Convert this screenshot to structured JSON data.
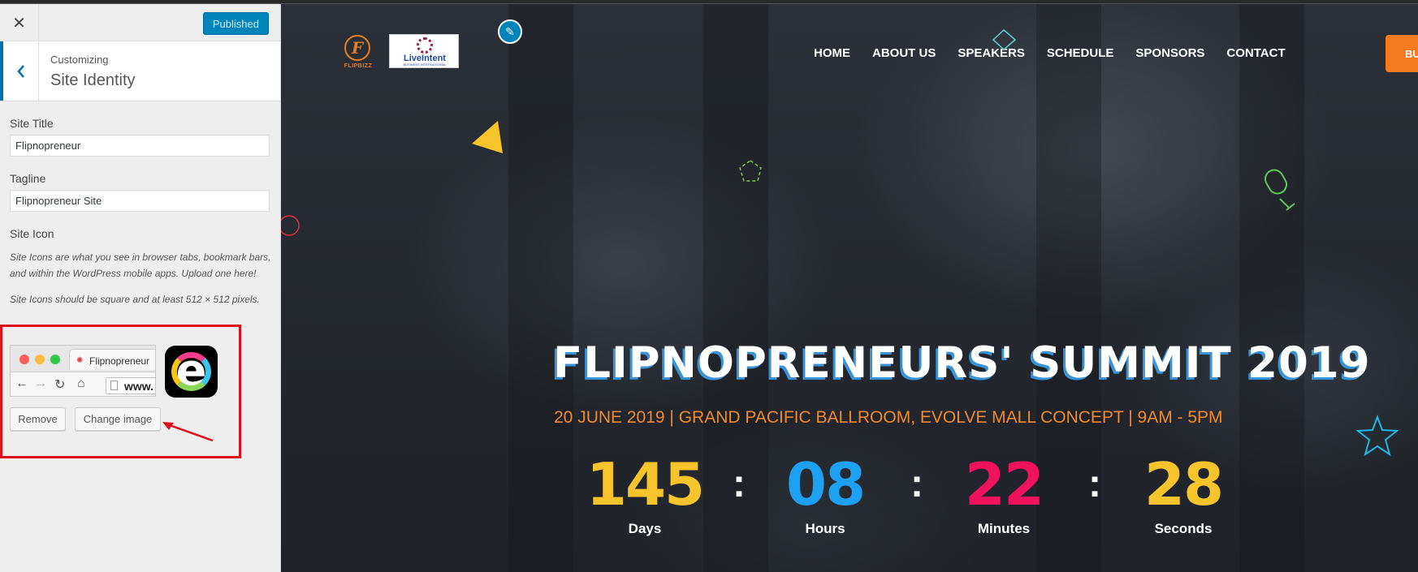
{
  "customizer": {
    "publish_label": "Published",
    "customizing_label": "Customizing",
    "section_title": "Site Identity",
    "site_title_label": "Site Title",
    "site_title_value": "Flipnopreneur",
    "tagline_label": "Tagline",
    "tagline_value": "Flipnopreneur Site",
    "site_icon_label": "Site Icon",
    "site_icon_desc": "Site Icons are what you see in browser tabs, bookmark bars, and within the WordPress mobile apps. Upload one here!",
    "site_icon_size_note": "Site Icons should be square and at least 512 × 512 pixels.",
    "preview_tab_text": "Flipnopreneur",
    "preview_url_text": "www.",
    "remove_label": "Remove",
    "change_image_label": "Change image"
  },
  "site": {
    "logo_flipbizz_text": "FLIPBIZZ",
    "logo_liveintent_name": "LiveIntent",
    "logo_liveintent_sub": "BUSINESS INTERNATIONAL",
    "nav": [
      "HOME",
      "ABOUT US",
      "SPEAKERS",
      "SCHEDULE",
      "SPONSORS",
      "CONTACT"
    ],
    "buy_label": "BU",
    "hero_title": "FLIPNOPRENEURS' SUMMIT 2019",
    "hero_subtitle": "20 JUNE 2019 | GRAND PACIFIC BALLROOM, EVOLVE MALL CONCEPT | 9AM - 5PM",
    "countdown": [
      {
        "value": "145",
        "label": "Days",
        "color": "#f7c52b"
      },
      {
        "value": "08",
        "label": "Hours",
        "color": "#1ea1f2"
      },
      {
        "value": "22",
        "label": "Minutes",
        "color": "#f0125c"
      },
      {
        "value": "28",
        "label": "Seconds",
        "color": "#f7c52b"
      }
    ],
    "separator": ":"
  },
  "colors": {
    "wp_blue": "#0085ba",
    "highlight_red": "#e0101b",
    "accent_orange": "#f47b20"
  }
}
